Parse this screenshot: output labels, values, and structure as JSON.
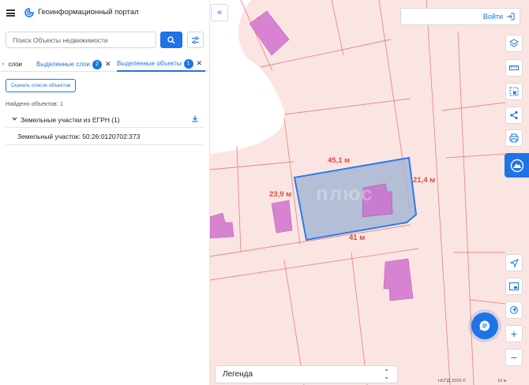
{
  "header": {
    "app_title": "Геоинформационный портал",
    "menu_icon": "hamburger-icon",
    "logo_icon": "portal-logo-icon"
  },
  "search": {
    "placeholder": "Поиск Объекты недвижимости",
    "value": ""
  },
  "tabs": [
    {
      "label": "слои",
      "badge": null,
      "active": false
    },
    {
      "label": "Выделенные слои",
      "badge": "2",
      "active": false
    },
    {
      "label": "Выделенные объекты",
      "badge": "1",
      "active": true
    }
  ],
  "results": {
    "download_button": "Скачать список объектов",
    "found_text": "Найдено объектов: 1",
    "group_label": "Земельные участки из ЕГРН (1)",
    "item_label": "Земельный участок: 50:26:0120702:373"
  },
  "map": {
    "login_label": "Войти",
    "legend_label": "Легенда",
    "watermark": "плюс",
    "dimension_labels": [
      "45,1 м",
      "21,4 м",
      "23,9 м",
      "41 м"
    ],
    "copyright": "НСПД 2026 ©",
    "scale_label": "10 м",
    "colors": {
      "parcel_fill": "#fbe5e3",
      "parcel_border": "#e98a7f",
      "building": "#d883d2",
      "selection_stroke": "#2c7bee",
      "selection_fill": "#a7b7d4",
      "dimension_text": "#e5483a",
      "accent": "#1e73e8"
    }
  },
  "toolbar": {
    "collapse_icon": "double-chevron-left-icon",
    "login_icon": "login-icon",
    "tools": [
      "layers-icon",
      "ruler-icon",
      "select-area-icon",
      "share-icon",
      "print-icon",
      "cadastre-active-icon",
      "locate-icon",
      "minimap-icon",
      "geolocation-icon",
      "zoom-in-icon",
      "zoom-out-icon"
    ],
    "chat_icon": "chat-icon"
  }
}
